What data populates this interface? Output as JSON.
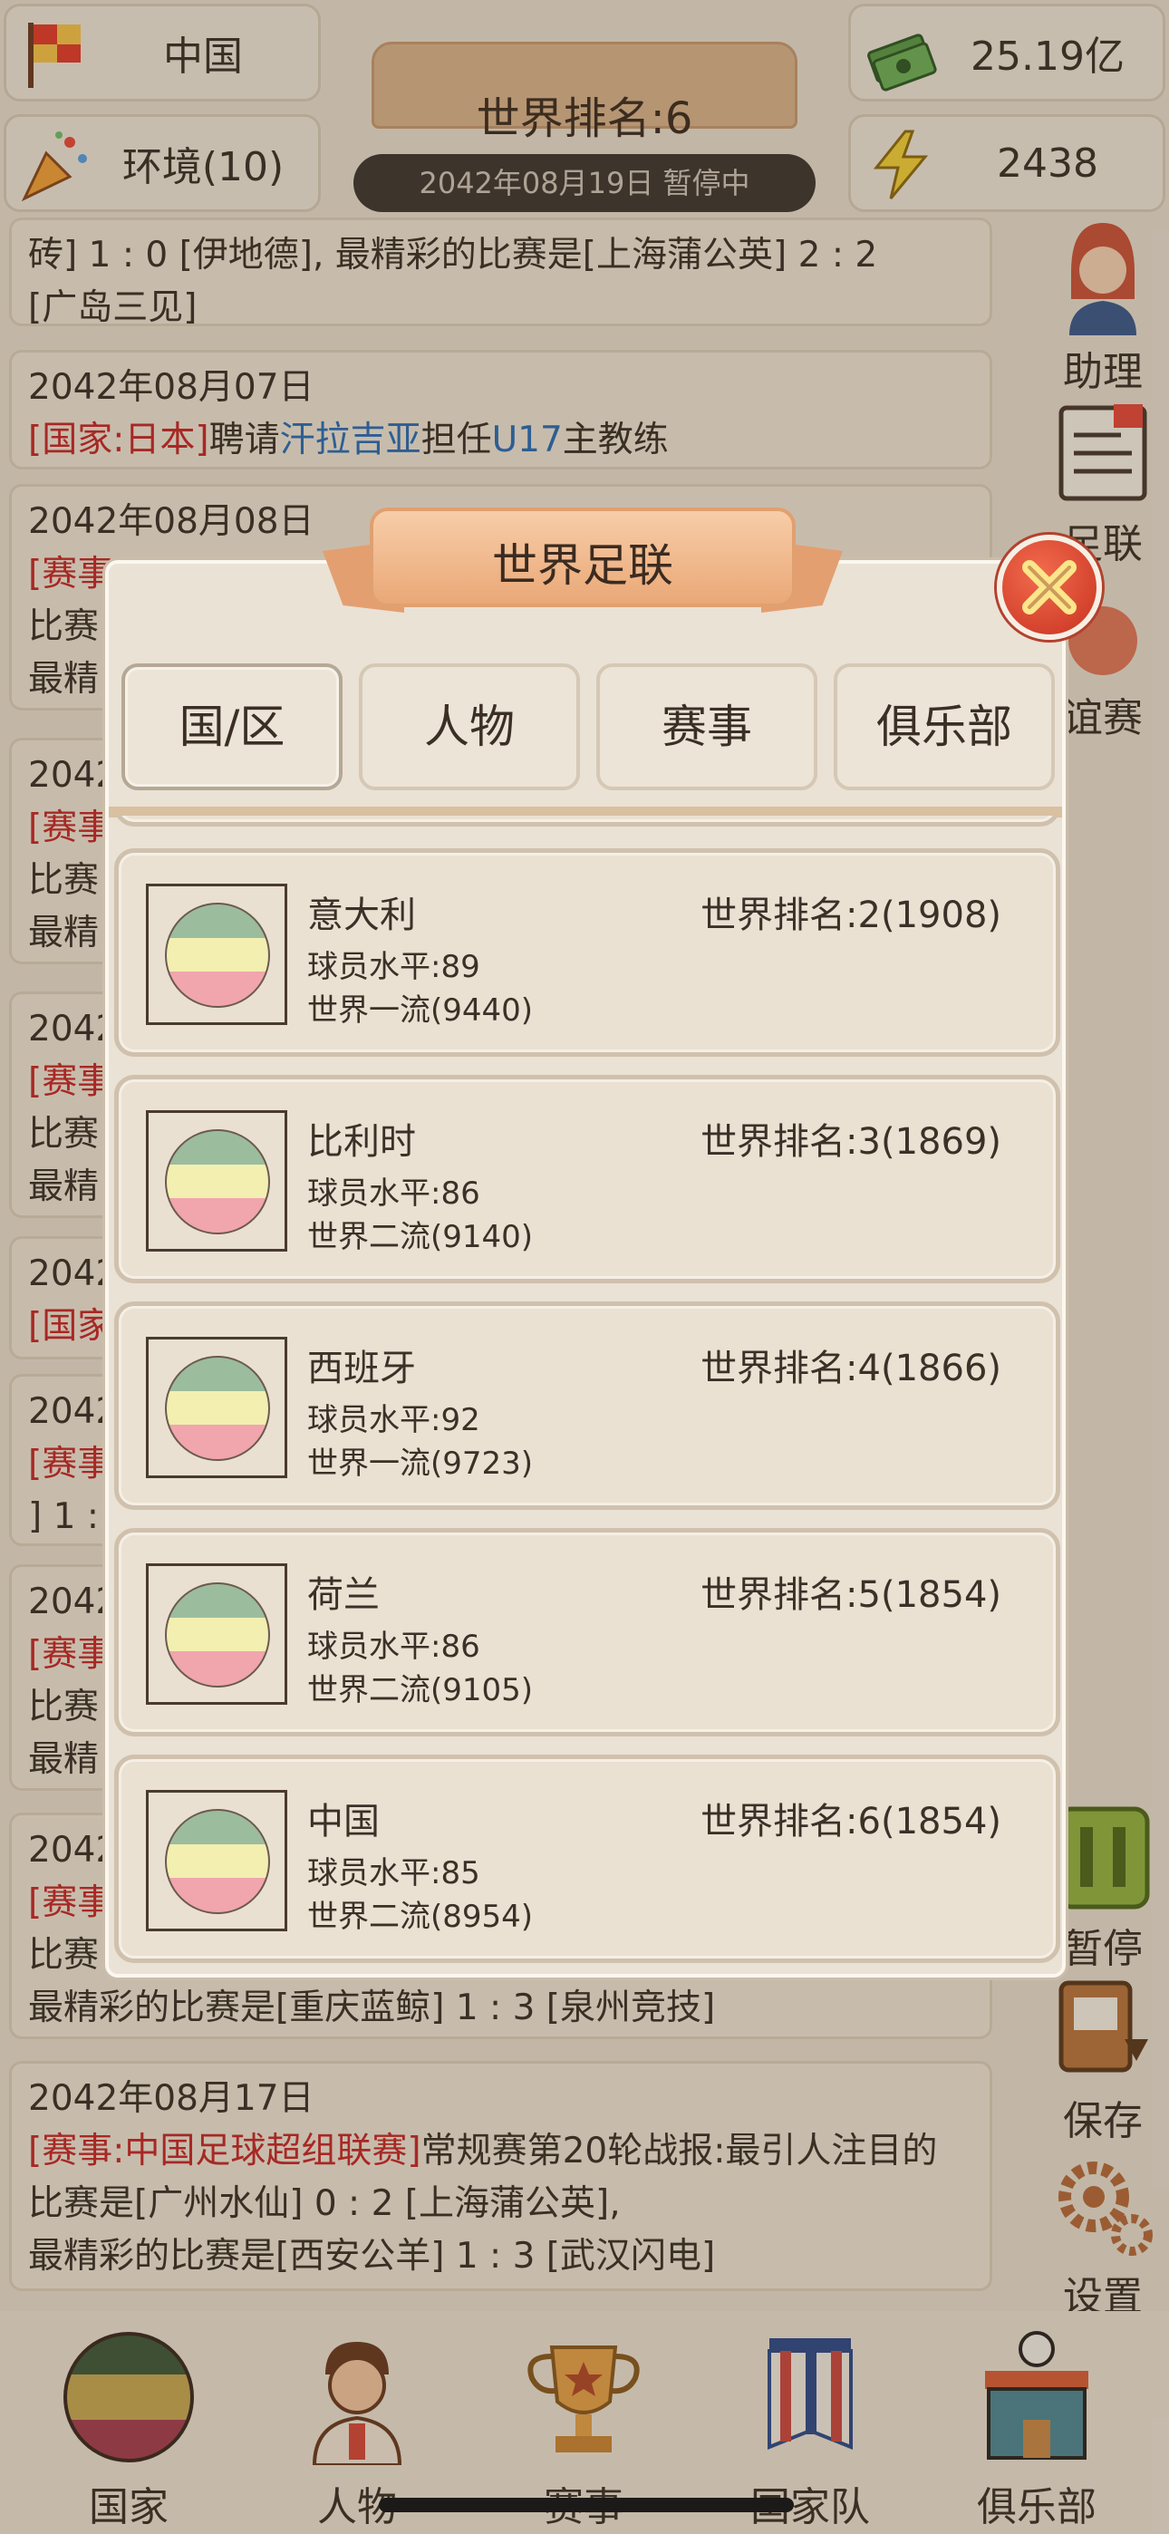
{
  "top": {
    "country": "中国",
    "environment": "环境(10)",
    "money": "25.19亿",
    "energy": "2438",
    "world_rank": "世界排名:6",
    "date_status": "2042年08月19日 暂停中"
  },
  "feed": [
    {
      "line1": "砖] 1 : 0 [伊地德], 最精彩的比赛是[上海蒲公英] 2 : 2",
      "line2": "[广岛三见]"
    },
    {
      "date": "2042年08月07日",
      "tag": "[国家:日本]",
      "t1": "聘请",
      "person": "汗拉吉亚",
      "t2": "担任",
      "team": "U17",
      "t3": "主教练"
    },
    {
      "date": "2042年08月08日",
      "tag": "[赛事",
      "l2": "比赛",
      "l3": "最精"
    },
    {
      "date": "2042",
      "tag": "[赛事",
      "l2": "比赛",
      "l3": "最精"
    },
    {
      "date": "2042",
      "tag": "[赛事",
      "l2": "比赛",
      "l3": "最精"
    },
    {
      "date": "2042",
      "tag": "[国家"
    },
    {
      "date": "2042",
      "tag": "[赛事",
      "l2": "] 1 :"
    },
    {
      "date": "2042",
      "tag": "[赛事",
      "l2": "比赛",
      "l3": "最精"
    },
    {
      "date": "2042",
      "tag": "[赛事",
      "l2": "比赛",
      "l3": "最精彩的比赛是[重庆蓝鲸] 1 : 3 [泉州竞技]"
    },
    {
      "date": "2042年08月17日",
      "tag": "[赛事:中国足球超组联赛]",
      "rest": "常规赛第20轮战报:最引人注目的",
      "l2": "比赛是[广州水仙] 0 : 2 [上海蒲公英],",
      "l3": "最精彩的比赛是[西安公羊] 1 : 3 [武汉闪电]"
    }
  ],
  "side": {
    "assistant": "助理",
    "federation": "足联",
    "friendly": "谊赛",
    "pause": "暂停",
    "save": "保存",
    "settings": "设置"
  },
  "nav": [
    "国家",
    "人物",
    "赛事",
    "国家队",
    "俱乐部"
  ],
  "modal": {
    "title": "世界足联",
    "tabs": [
      "国/区",
      "人物",
      "赛事",
      "俱乐部"
    ],
    "countries": [
      {
        "name": "意大利",
        "level": "球员水平:89",
        "tier": "世界一流(9440)",
        "rank": "世界排名:2(1908)"
      },
      {
        "name": "比利时",
        "level": "球员水平:86",
        "tier": "世界二流(9140)",
        "rank": "世界排名:3(1869)"
      },
      {
        "name": "西班牙",
        "level": "球员水平:92",
        "tier": "世界一流(9723)",
        "rank": "世界排名:4(1866)"
      },
      {
        "name": "荷兰",
        "level": "球员水平:86",
        "tier": "世界二流(9105)",
        "rank": "世界排名:5(1854)"
      },
      {
        "name": "中国",
        "level": "球员水平:85",
        "tier": "世界二流(8954)",
        "rank": "世界排名:6(1854)"
      }
    ]
  },
  "colors": {
    "accent_red": "#c62828",
    "link_blue": "#2a6db5",
    "panel": "#eae2d5"
  }
}
